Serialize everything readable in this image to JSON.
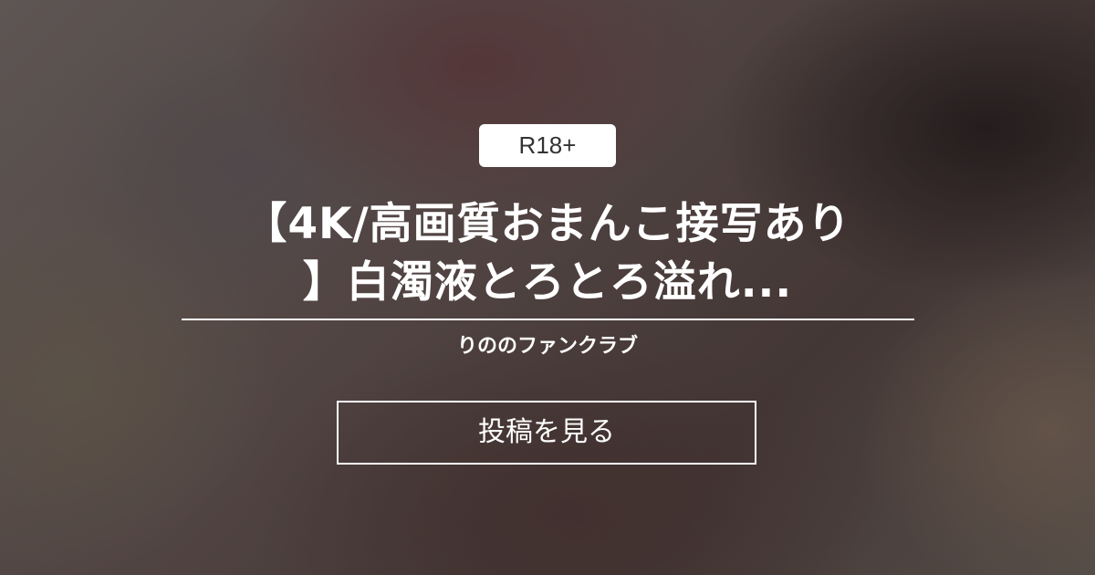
{
  "badge": {
    "label": "R18+"
  },
  "post": {
    "title": "【4K/高画質おまんこ接写あり\n】白濁液とろとろ溢れ..."
  },
  "fanclub": {
    "name": "りののファンクラブ"
  },
  "cta": {
    "label": "投稿を見る"
  },
  "colors": {
    "badge_bg": "#ffffff",
    "badge_text": "#333333",
    "foreground": "#ffffff"
  }
}
